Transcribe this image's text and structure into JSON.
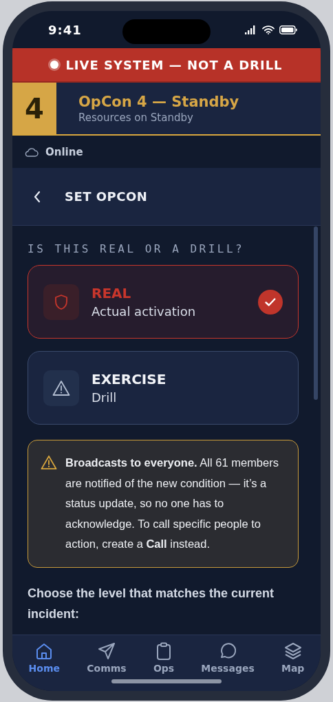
{
  "status_bar": {
    "time": "9:41"
  },
  "banner": {
    "text": "LIVE SYSTEM — NOT A DRILL"
  },
  "opcon": {
    "level": "4",
    "title": "OpCon 4 — Standby",
    "subtitle": "Resources on Standby"
  },
  "connection": {
    "label": "Online"
  },
  "header": {
    "title": "SET OPCON"
  },
  "question": "IS THIS REAL OR A DRILL?",
  "options": [
    {
      "kind": "real",
      "title": "REAL",
      "subtitle": "Actual activation",
      "selected": true
    },
    {
      "kind": "exercise",
      "title": "EXERCISE",
      "subtitle": "Drill",
      "selected": false
    }
  ],
  "notice": {
    "text": "**Broadcasts to everyone.** All 61 members are notified of the new condition — it’s a status update, so no one has to acknowledge. To call specific people to action, create a **Call** instead."
  },
  "prompt": "Choose the level that matches the current incident:",
  "tabs": [
    {
      "label": "Home",
      "selected": true
    },
    {
      "label": "Comms",
      "selected": false
    },
    {
      "label": "Ops",
      "selected": false
    },
    {
      "label": "Messages",
      "selected": false
    },
    {
      "label": "Map",
      "selected": false
    }
  ]
}
